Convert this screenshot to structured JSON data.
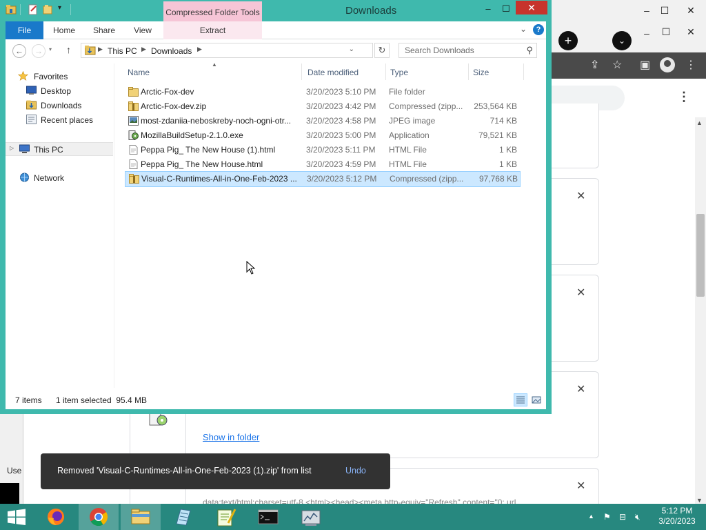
{
  "explorer": {
    "title": "Downloads",
    "context_tab": "Compressed Folder Tools",
    "ribbon_tabs": [
      "File",
      "Home",
      "Share",
      "View",
      "Extract"
    ],
    "breadcrumb": [
      "This PC",
      "Downloads"
    ],
    "search_placeholder": "Search Downloads",
    "nav_pane": {
      "favorites": "Favorites",
      "desktop": "Desktop",
      "downloads": "Downloads",
      "recent": "Recent places",
      "this_pc": "This PC",
      "network": "Network"
    },
    "columns": {
      "name": "Name",
      "date": "Date modified",
      "type": "Type",
      "size": "Size"
    },
    "files": [
      {
        "name": "Arctic-Fox-dev",
        "date": "3/20/2023 5:10 PM",
        "type": "File folder",
        "size": "",
        "icon": "folder-icon"
      },
      {
        "name": "Arctic-Fox-dev.zip",
        "date": "3/20/2023 4:42 PM",
        "type": "Compressed (zipp...",
        "size": "253,564 KB",
        "icon": "zip-folder-icon"
      },
      {
        "name": "most-zdaniia-neboskreby-noch-ogni-otr...",
        "date": "3/20/2023 4:58 PM",
        "type": "JPEG image",
        "size": "714 KB",
        "icon": "image-file-icon"
      },
      {
        "name": "MozillaBuildSetup-2.1.0.exe",
        "date": "3/20/2023 5:00 PM",
        "type": "Application",
        "size": "79,521 KB",
        "icon": "installer-icon"
      },
      {
        "name": "Peppa Pig_ The New House (1).html",
        "date": "3/20/2023 5:11 PM",
        "type": "HTML File",
        "size": "1 KB",
        "icon": "html-file-icon"
      },
      {
        "name": "Peppa Pig_ The New House.html",
        "date": "3/20/2023 4:59 PM",
        "type": "HTML File",
        "size": "1 KB",
        "icon": "html-file-icon"
      },
      {
        "name": "Visual-C-Runtimes-All-in-One-Feb-2023 ...",
        "date": "3/20/2023 5:12 PM",
        "type": "Compressed (zipp...",
        "size": "97,768 KB",
        "icon": "zip-folder-icon",
        "selected": true
      }
    ],
    "status": {
      "count": "7 items",
      "selected": "1 item selected  95.4 MB"
    }
  },
  "browser": {
    "show_in_folder": "Show in folder",
    "url_text": "data:text/html;charset=utf-8,<html><head><meta http-equiv=\"Refresh\" content=\"0; url...",
    "left_edge_text": "Use"
  },
  "toast": {
    "message": "Removed 'Visual-C-Runtimes-All-in-One-Feb-2023 (1).zip' from list",
    "action": "Undo"
  },
  "taskbar": {
    "time": "5:12 PM",
    "date": "3/20/2023",
    "apps": [
      "firefox-icon",
      "chrome-icon",
      "file-explorer-icon",
      "notepad-icon",
      "notepad-plus-plus-icon",
      "command-prompt-icon",
      "server-manager-icon"
    ]
  },
  "colors": {
    "explorer_frame": "#3fb9ad",
    "taskbar": "#27887f",
    "selection": "#cce8ff",
    "file_tab": "#1979ca",
    "toast_bg": "#323232",
    "link": "#1a73e8"
  }
}
